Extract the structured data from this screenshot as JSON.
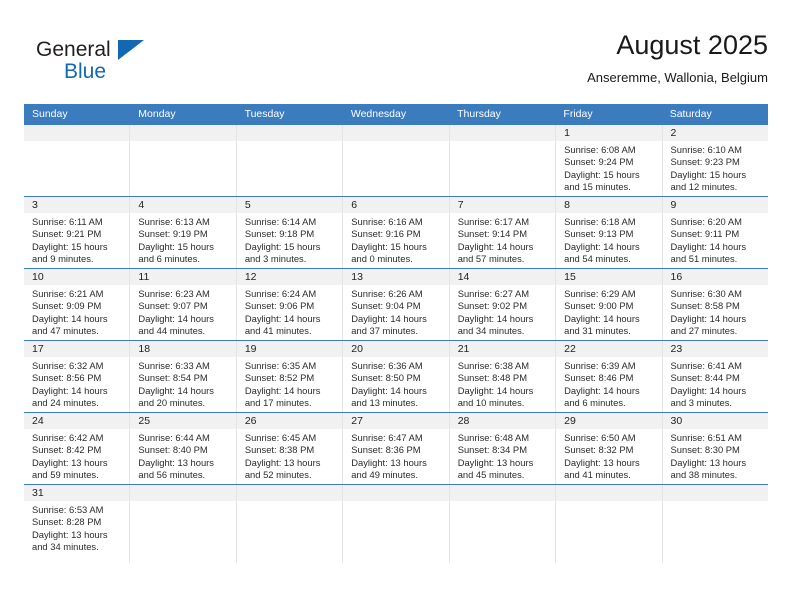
{
  "brand": {
    "name_top": "General",
    "name_bottom": "Blue",
    "accent_color": "#1268b3",
    "triangle_icon": "blue-triangle-logo-icon"
  },
  "header": {
    "title": "August 2025",
    "subtitle": "Anseremme, Wallonia, Belgium"
  },
  "calendar": {
    "header_bg": "#3a7cbe",
    "daynum_bg": "#f1f1f1",
    "weekday_headers": [
      "Sunday",
      "Monday",
      "Tuesday",
      "Wednesday",
      "Thursday",
      "Friday",
      "Saturday"
    ],
    "weeks": [
      [
        {
          "day": "",
          "lines": []
        },
        {
          "day": "",
          "lines": []
        },
        {
          "day": "",
          "lines": []
        },
        {
          "day": "",
          "lines": []
        },
        {
          "day": "",
          "lines": []
        },
        {
          "day": "1",
          "lines": [
            "Sunrise: 6:08 AM",
            "Sunset: 9:24 PM",
            "Daylight: 15 hours",
            "and 15 minutes."
          ]
        },
        {
          "day": "2",
          "lines": [
            "Sunrise: 6:10 AM",
            "Sunset: 9:23 PM",
            "Daylight: 15 hours",
            "and 12 minutes."
          ]
        }
      ],
      [
        {
          "day": "3",
          "lines": [
            "Sunrise: 6:11 AM",
            "Sunset: 9:21 PM",
            "Daylight: 15 hours",
            "and 9 minutes."
          ]
        },
        {
          "day": "4",
          "lines": [
            "Sunrise: 6:13 AM",
            "Sunset: 9:19 PM",
            "Daylight: 15 hours",
            "and 6 minutes."
          ]
        },
        {
          "day": "5",
          "lines": [
            "Sunrise: 6:14 AM",
            "Sunset: 9:18 PM",
            "Daylight: 15 hours",
            "and 3 minutes."
          ]
        },
        {
          "day": "6",
          "lines": [
            "Sunrise: 6:16 AM",
            "Sunset: 9:16 PM",
            "Daylight: 15 hours",
            "and 0 minutes."
          ]
        },
        {
          "day": "7",
          "lines": [
            "Sunrise: 6:17 AM",
            "Sunset: 9:14 PM",
            "Daylight: 14 hours",
            "and 57 minutes."
          ]
        },
        {
          "day": "8",
          "lines": [
            "Sunrise: 6:18 AM",
            "Sunset: 9:13 PM",
            "Daylight: 14 hours",
            "and 54 minutes."
          ]
        },
        {
          "day": "9",
          "lines": [
            "Sunrise: 6:20 AM",
            "Sunset: 9:11 PM",
            "Daylight: 14 hours",
            "and 51 minutes."
          ]
        }
      ],
      [
        {
          "day": "10",
          "lines": [
            "Sunrise: 6:21 AM",
            "Sunset: 9:09 PM",
            "Daylight: 14 hours",
            "and 47 minutes."
          ]
        },
        {
          "day": "11",
          "lines": [
            "Sunrise: 6:23 AM",
            "Sunset: 9:07 PM",
            "Daylight: 14 hours",
            "and 44 minutes."
          ]
        },
        {
          "day": "12",
          "lines": [
            "Sunrise: 6:24 AM",
            "Sunset: 9:06 PM",
            "Daylight: 14 hours",
            "and 41 minutes."
          ]
        },
        {
          "day": "13",
          "lines": [
            "Sunrise: 6:26 AM",
            "Sunset: 9:04 PM",
            "Daylight: 14 hours",
            "and 37 minutes."
          ]
        },
        {
          "day": "14",
          "lines": [
            "Sunrise: 6:27 AM",
            "Sunset: 9:02 PM",
            "Daylight: 14 hours",
            "and 34 minutes."
          ]
        },
        {
          "day": "15",
          "lines": [
            "Sunrise: 6:29 AM",
            "Sunset: 9:00 PM",
            "Daylight: 14 hours",
            "and 31 minutes."
          ]
        },
        {
          "day": "16",
          "lines": [
            "Sunrise: 6:30 AM",
            "Sunset: 8:58 PM",
            "Daylight: 14 hours",
            "and 27 minutes."
          ]
        }
      ],
      [
        {
          "day": "17",
          "lines": [
            "Sunrise: 6:32 AM",
            "Sunset: 8:56 PM",
            "Daylight: 14 hours",
            "and 24 minutes."
          ]
        },
        {
          "day": "18",
          "lines": [
            "Sunrise: 6:33 AM",
            "Sunset: 8:54 PM",
            "Daylight: 14 hours",
            "and 20 minutes."
          ]
        },
        {
          "day": "19",
          "lines": [
            "Sunrise: 6:35 AM",
            "Sunset: 8:52 PM",
            "Daylight: 14 hours",
            "and 17 minutes."
          ]
        },
        {
          "day": "20",
          "lines": [
            "Sunrise: 6:36 AM",
            "Sunset: 8:50 PM",
            "Daylight: 14 hours",
            "and 13 minutes."
          ]
        },
        {
          "day": "21",
          "lines": [
            "Sunrise: 6:38 AM",
            "Sunset: 8:48 PM",
            "Daylight: 14 hours",
            "and 10 minutes."
          ]
        },
        {
          "day": "22",
          "lines": [
            "Sunrise: 6:39 AM",
            "Sunset: 8:46 PM",
            "Daylight: 14 hours",
            "and 6 minutes."
          ]
        },
        {
          "day": "23",
          "lines": [
            "Sunrise: 6:41 AM",
            "Sunset: 8:44 PM",
            "Daylight: 14 hours",
            "and 3 minutes."
          ]
        }
      ],
      [
        {
          "day": "24",
          "lines": [
            "Sunrise: 6:42 AM",
            "Sunset: 8:42 PM",
            "Daylight: 13 hours",
            "and 59 minutes."
          ]
        },
        {
          "day": "25",
          "lines": [
            "Sunrise: 6:44 AM",
            "Sunset: 8:40 PM",
            "Daylight: 13 hours",
            "and 56 minutes."
          ]
        },
        {
          "day": "26",
          "lines": [
            "Sunrise: 6:45 AM",
            "Sunset: 8:38 PM",
            "Daylight: 13 hours",
            "and 52 minutes."
          ]
        },
        {
          "day": "27",
          "lines": [
            "Sunrise: 6:47 AM",
            "Sunset: 8:36 PM",
            "Daylight: 13 hours",
            "and 49 minutes."
          ]
        },
        {
          "day": "28",
          "lines": [
            "Sunrise: 6:48 AM",
            "Sunset: 8:34 PM",
            "Daylight: 13 hours",
            "and 45 minutes."
          ]
        },
        {
          "day": "29",
          "lines": [
            "Sunrise: 6:50 AM",
            "Sunset: 8:32 PM",
            "Daylight: 13 hours",
            "and 41 minutes."
          ]
        },
        {
          "day": "30",
          "lines": [
            "Sunrise: 6:51 AM",
            "Sunset: 8:30 PM",
            "Daylight: 13 hours",
            "and 38 minutes."
          ]
        }
      ],
      [
        {
          "day": "31",
          "lines": [
            "Sunrise: 6:53 AM",
            "Sunset: 8:28 PM",
            "Daylight: 13 hours",
            "and 34 minutes."
          ]
        },
        {
          "day": "",
          "lines": []
        },
        {
          "day": "",
          "lines": []
        },
        {
          "day": "",
          "lines": []
        },
        {
          "day": "",
          "lines": []
        },
        {
          "day": "",
          "lines": []
        },
        {
          "day": "",
          "lines": []
        }
      ]
    ]
  }
}
